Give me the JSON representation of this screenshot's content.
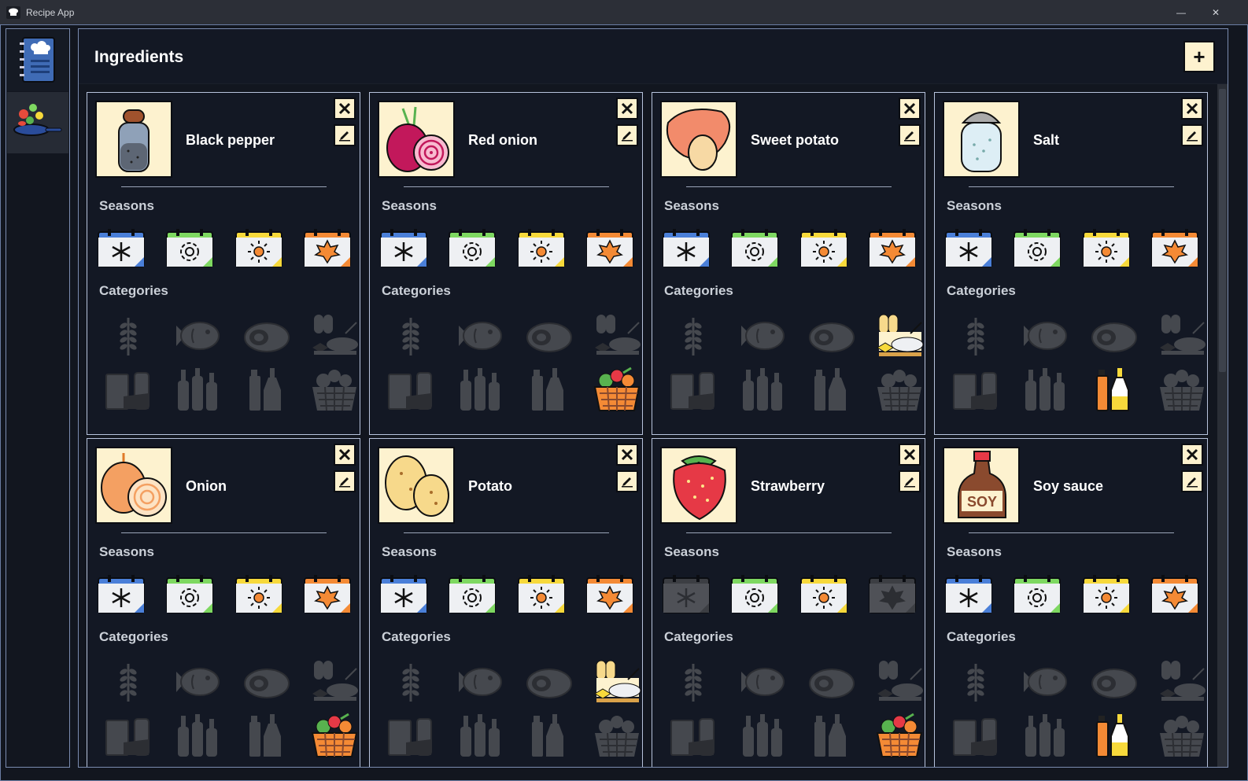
{
  "window": {
    "title": "Recipe App",
    "minimize_glyph": "—",
    "close_glyph": "✕"
  },
  "sidebar": {
    "items": [
      {
        "name": "recipes",
        "icon": "recipe-book-icon"
      },
      {
        "name": "ingredients",
        "icon": "cooking-pan-icon",
        "active": true
      }
    ]
  },
  "header": {
    "title": "Ingredients",
    "add_label": "+"
  },
  "labels": {
    "seasons": "Seasons",
    "categories": "Categories"
  },
  "seasons_order": [
    "winter",
    "spring",
    "summer",
    "autumn"
  ],
  "categories_order": [
    "grains",
    "fish",
    "meat",
    "pasta-rice-bread",
    "dairy",
    "beverages",
    "oil-vinegar",
    "fruits-vegetables"
  ],
  "colors": {
    "winter": "#4a7fd8",
    "spring": "#7ed861",
    "summer": "#f7d93b",
    "autumn": "#f48a35",
    "card_image_bg": "#fdf2cf",
    "disabled": "#4a4d53"
  },
  "ingredients": [
    {
      "name": "Black pepper",
      "image": "pepper-shaker-icon",
      "seasons": [
        true,
        true,
        true,
        true
      ],
      "categories": [
        false,
        false,
        false,
        false,
        false,
        false,
        false,
        false
      ]
    },
    {
      "name": "Red onion",
      "image": "red-onion-icon",
      "seasons": [
        true,
        true,
        true,
        true
      ],
      "categories": [
        false,
        false,
        false,
        false,
        false,
        false,
        false,
        true
      ]
    },
    {
      "name": "Sweet potato",
      "image": "sweet-potato-icon",
      "seasons": [
        true,
        true,
        true,
        true
      ],
      "categories": [
        false,
        false,
        false,
        true,
        false,
        false,
        false,
        false
      ]
    },
    {
      "name": "Salt",
      "image": "salt-shaker-icon",
      "seasons": [
        true,
        true,
        true,
        true
      ],
      "categories": [
        false,
        false,
        false,
        false,
        false,
        false,
        true,
        false
      ]
    },
    {
      "name": "Onion",
      "image": "onion-icon",
      "seasons": [
        true,
        true,
        true,
        true
      ],
      "categories": [
        false,
        false,
        false,
        false,
        false,
        false,
        false,
        true
      ]
    },
    {
      "name": "Potato",
      "image": "potato-icon",
      "seasons": [
        true,
        true,
        true,
        true
      ],
      "categories": [
        false,
        false,
        false,
        true,
        false,
        false,
        false,
        false
      ]
    },
    {
      "name": "Strawberry",
      "image": "strawberry-icon",
      "seasons": [
        false,
        true,
        true,
        false
      ],
      "categories": [
        false,
        false,
        false,
        false,
        false,
        false,
        false,
        true
      ]
    },
    {
      "name": "Soy sauce",
      "image": "soy-sauce-bottle-icon",
      "seasons": [
        true,
        true,
        true,
        true
      ],
      "categories": [
        false,
        false,
        false,
        false,
        false,
        false,
        true,
        false
      ]
    }
  ]
}
